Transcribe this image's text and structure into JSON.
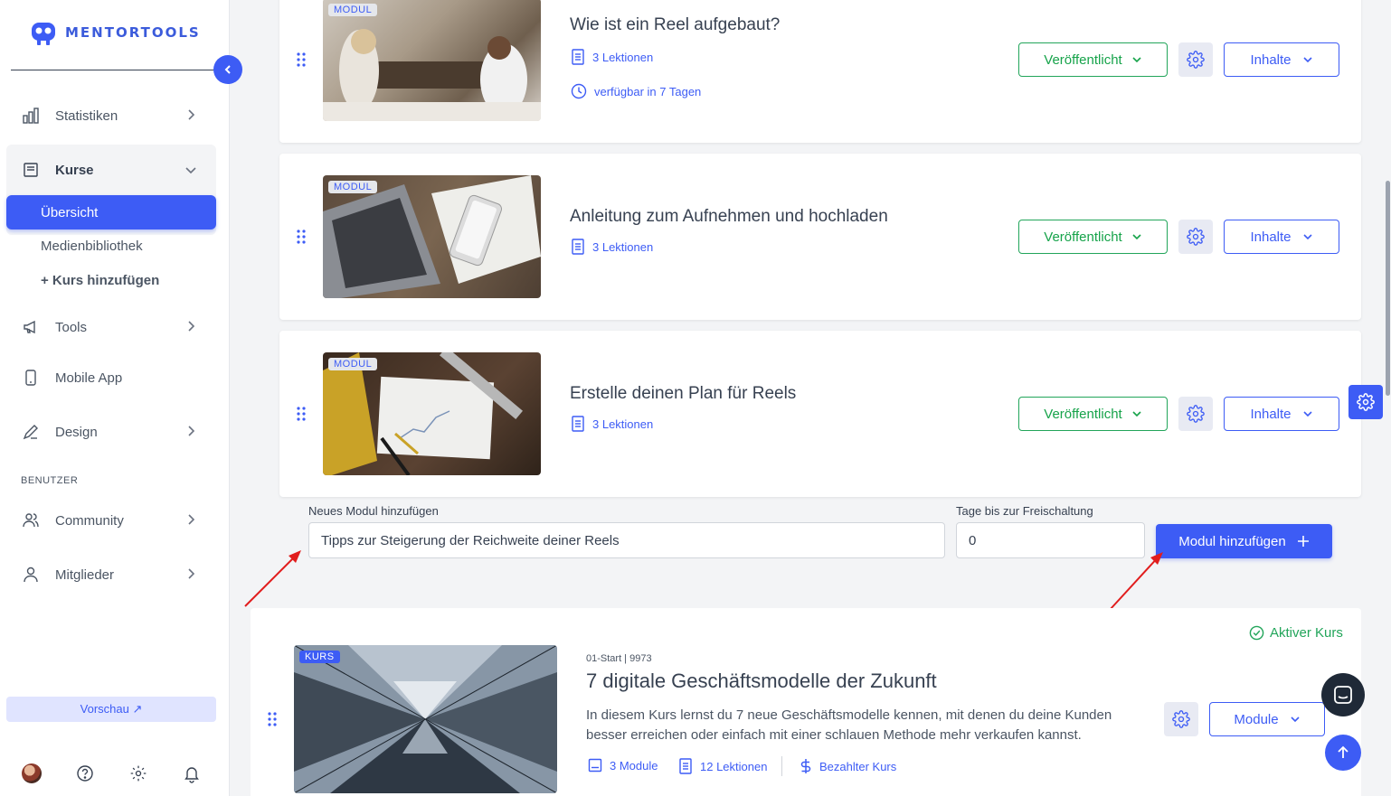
{
  "app": {
    "logo_text": "MENTORTOOLS"
  },
  "sidebar": {
    "items": [
      {
        "label": "Statistiken",
        "icon": "bar-chart-icon"
      },
      {
        "label": "Kurse",
        "icon": "book-icon"
      },
      {
        "label": "Tools",
        "icon": "megaphone-icon"
      },
      {
        "label": "Mobile App",
        "icon": "phone-icon"
      },
      {
        "label": "Design",
        "icon": "pen-icon"
      },
      {
        "label": "Community",
        "icon": "users-icon"
      },
      {
        "label": "Mitglieder",
        "icon": "user-icon"
      }
    ],
    "kurse_sub": {
      "active": "Übersicht",
      "media": "Medienbibliothek",
      "add": "+ Kurs hinzufügen"
    },
    "section_label": "BENUTZER",
    "preview_label": "Vorschau ↗"
  },
  "modules": [
    {
      "badge": "MODUL",
      "title": "Wie ist ein Reel aufgebaut?",
      "lessons": "3 Lektionen",
      "availability": "verfügbar in 7 Tagen",
      "status": "Veröffentlicht",
      "content_label": "Inhalte"
    },
    {
      "badge": "MODUL",
      "title": "Anleitung zum Aufnehmen und hochladen",
      "lessons": "3 Lektionen",
      "status": "Veröffentlicht",
      "content_label": "Inhalte"
    },
    {
      "badge": "MODUL",
      "title": "Erstelle deinen Plan für Reels",
      "lessons": "3 Lektionen",
      "status": "Veröffentlicht",
      "content_label": "Inhalte"
    }
  ],
  "new_module": {
    "label": "Neues Modul hinzufügen",
    "value": "Tipps zur Steigerung der Reichweite deiner Reels",
    "days_label": "Tage bis zur Freischaltung",
    "days_value": "0",
    "button": "Modul hinzufügen"
  },
  "course": {
    "badge": "KURS",
    "status": "Aktiver Kurs",
    "subtitle": "01-Start | 9973",
    "title": "7 digitale Geschäftsmodelle der Zukunft",
    "description": "In diesem Kurs lernst du 7 neue Geschäftsmodelle kennen, mit denen du deine Kunden besser erreichen oder einfach mit einer schlauen Methode mehr verkaufen kannst.",
    "modules": "3 Module",
    "lessons": "12 Lektionen",
    "type": "Bezahlter Kurs",
    "modules_button": "Module"
  },
  "colors": {
    "primary": "#3d5cf5",
    "success": "#16a34a",
    "annotation": "#e11d1d"
  }
}
